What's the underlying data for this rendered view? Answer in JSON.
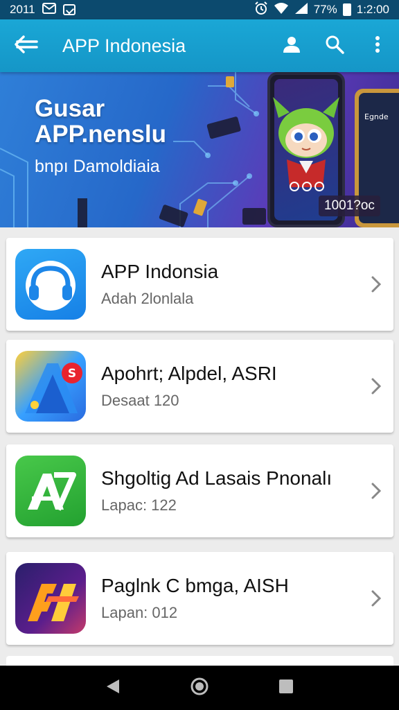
{
  "status_bar": {
    "left_text": "2011",
    "battery": "77%",
    "time": "1:2:00",
    "icons": [
      "mail-icon",
      "check-box-icon",
      "alarm-icon",
      "wifi-icon",
      "signal-icon",
      "battery-icon"
    ]
  },
  "app_bar": {
    "title": "APP Indonesia",
    "icons": [
      "back-arrow-icon",
      "account-icon",
      "search-icon",
      "more-vert-icon"
    ]
  },
  "banner": {
    "headline_line1": "Gusar",
    "headline_line2": "APP.nenslu",
    "subtitle": "bnpı Damoldiaia",
    "phone_screen_text": "Egnde",
    "counter": "1001?oc"
  },
  "apps": [
    {
      "name": "APP Indonsia",
      "meta": "Adah 2lonlala",
      "icon": "headphones-icon"
    },
    {
      "name": "Apohrt; Alpdel, ASRI",
      "meta": "Desaat 120",
      "icon": "maps-icon"
    },
    {
      "name": "Shgoltig Ad  Lasais Pnonalı",
      "meta": "Lapac: 122",
      "icon": "ad-icon"
    },
    {
      "name": "Paglnk C bmga, AISH",
      "meta": "Lapan: 012",
      "icon": "fi-icon"
    }
  ],
  "nav_bar": {
    "icons": [
      "nav-back-icon",
      "nav-home-icon",
      "nav-recents-icon"
    ]
  },
  "colors": {
    "status_bar": "#0c4a6e",
    "app_bar": "#1aa7d6",
    "background": "#ececec",
    "card": "#ffffff"
  }
}
